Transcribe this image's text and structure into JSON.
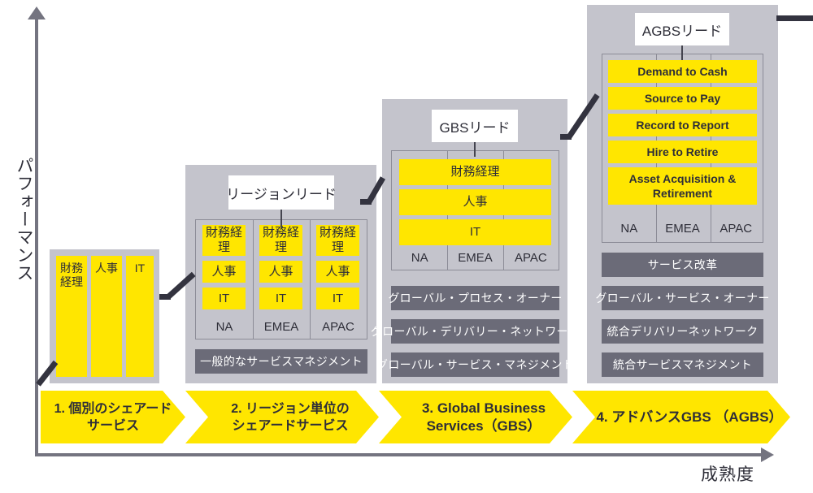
{
  "axes": {
    "y_label": "パフォーマンス",
    "x_label": "成熟度"
  },
  "stages": [
    {
      "id": "stage-1",
      "lead": null,
      "columns": [
        "財務経理",
        "人事",
        "IT"
      ],
      "regions": [],
      "support_bars": [],
      "banner": "1. 個別のシェアード\nサービス",
      "banner_number": "1."
    },
    {
      "id": "stage-2",
      "lead": "リージョンリード",
      "functions": [
        "財務経理",
        "人事",
        "IT"
      ],
      "regions": [
        "NA",
        "EMEA",
        "APAC"
      ],
      "support_bars": [
        "一般的なサービスマネジメント"
      ],
      "banner": "2. リージョン単位の\nシェアードサービス"
    },
    {
      "id": "stage-3",
      "lead": "GBSリード",
      "functions": [
        "財務経理",
        "人事",
        "IT"
      ],
      "regions": [
        "NA",
        "EMEA",
        "APAC"
      ],
      "support_bars": [
        "グローバル・プロセス・オーナー",
        "グローバル・デリバリー・ネットワーク",
        "グローバル・サービス・マネジメント"
      ],
      "banner": "3. Global Business\nServices（GBS）"
    },
    {
      "id": "stage-4",
      "lead": "AGBSリード",
      "functions": [
        "Demand to Cash",
        "Source to Pay",
        "Record to Report",
        "Hire to Retire",
        "Asset Acquisition &\nRetirement"
      ],
      "regions": [
        "NA",
        "EMEA",
        "APAC"
      ],
      "support_bars": [
        "サービス改革",
        "グローバル・サービス・オーナー",
        "統合デリバリーネットワーク",
        "統合サービスマネジメント"
      ],
      "banner": "4. アドバンスGBS （AGBS）"
    }
  ],
  "s1": {
    "c0": "財務経理",
    "c1": "人事",
    "c2": "IT",
    "banner": "1. 個別のシェアード\nサービス"
  },
  "s2": {
    "lead": "リージョンリード",
    "f0": "財務経理",
    "f1": "人事",
    "f2": "IT",
    "f0b": "財務経理",
    "f1b": "人事",
    "f2b": "IT",
    "f0c": "財務経理",
    "f1c": "人事",
    "f2c": "IT",
    "r0": "NA",
    "r1": "EMEA",
    "r2": "APAC",
    "d0": "一般的なサービスマネジメント",
    "banner": "2. リージョン単位の\nシェアードサービス"
  },
  "s3": {
    "lead": "GBSリード",
    "f0": "財務経理",
    "f1": "人事",
    "f2": "IT",
    "r0": "NA",
    "r1": "EMEA",
    "r2": "APAC",
    "d0": "グローバル・プロセス・オーナー",
    "d1": "グローバル・デリバリー・ネットワーク",
    "d2": "グローバル・サービス・マネジメント",
    "banner": "3. Global Business\nServices（GBS）"
  },
  "s4": {
    "lead": "AGBSリード",
    "f0": "Demand to Cash",
    "f1": "Source to Pay",
    "f2": "Record to Report",
    "f3": "Hire to Retire",
    "f4": "Asset Acquisition &\nRetirement",
    "r0": "NA",
    "r1": "EMEA",
    "r2": "APAC",
    "d0": "サービス改革",
    "d1": "グローバル・サービス・オーナー",
    "d2": "統合デリバリーネットワーク",
    "d3": "統合サービスマネジメント",
    "banner": "4. アドバンスGBS （AGBS）"
  },
  "colors": {
    "yellow": "#ffe600",
    "light_gray": "#c4c4cc",
    "dark_gray": "#6b6b78",
    "axis_gray": "#747480",
    "text": "#2e2e38",
    "connector": "#33333f",
    "white": "#ffffff"
  }
}
